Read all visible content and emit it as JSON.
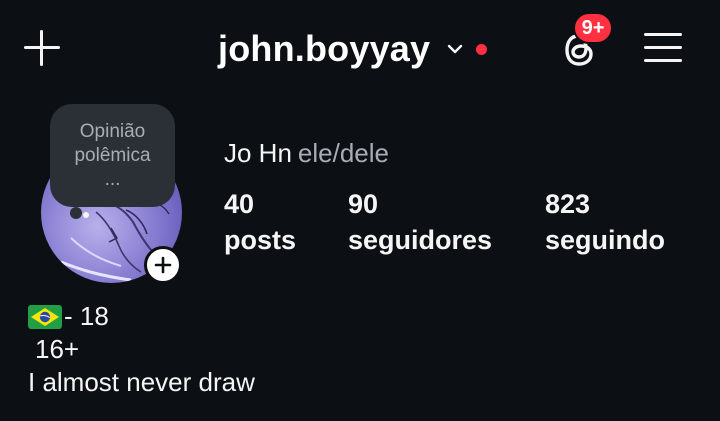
{
  "header": {
    "username": "john.boyyay",
    "notification_badge": "9+",
    "icons": [
      "plus-icon",
      "chevron-down-icon",
      "threads-icon",
      "menu-icon"
    ]
  },
  "note": {
    "line1": "Opinião",
    "line2": "polêmica",
    "line3": "..."
  },
  "profile": {
    "display_name": "Jo Hn",
    "pronouns": "ele/dele",
    "stats": [
      {
        "value": "40",
        "label": "posts"
      },
      {
        "value": "90",
        "label": "seguidores"
      },
      {
        "value": "823",
        "label": "seguindo"
      }
    ]
  },
  "bio": {
    "line1_text": "- 18",
    "line2": "16+",
    "line3": "I almost never draw"
  },
  "colors": {
    "background": "#0c0f14",
    "badge": "#ff3040",
    "note_bubble": "#2b2f36",
    "muted_text": "#a8adb4"
  }
}
